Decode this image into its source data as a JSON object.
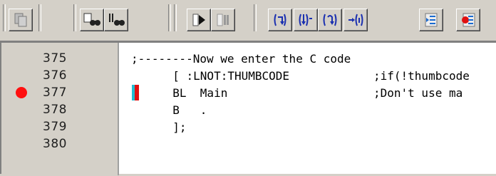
{
  "toolbar": {
    "buttons": [
      {
        "name": "copy-button",
        "icon": "copy-icon"
      },
      {
        "name": "find-button",
        "icon": "find-icon"
      },
      {
        "name": "find-next-button",
        "icon": "find-next-icon"
      },
      {
        "name": "run-button",
        "icon": "run-icon"
      },
      {
        "name": "stop-button",
        "icon": "stop-icon"
      },
      {
        "name": "step-over-button",
        "icon": "step-over-icon"
      },
      {
        "name": "step-into-button",
        "icon": "step-into-icon"
      },
      {
        "name": "step-out-button",
        "icon": "step-out-icon"
      },
      {
        "name": "run-to-cursor-button",
        "icon": "run-to-cursor-icon"
      },
      {
        "name": "indent-button",
        "icon": "indent-icon"
      },
      {
        "name": "breakpoint-button",
        "icon": "breakpoint-icon"
      }
    ]
  },
  "editor": {
    "lines": [
      {
        "number": "375",
        "col1": ";--------Now we enter the C code",
        "col2": "",
        "breakpoint": false,
        "current": false
      },
      {
        "number": "376",
        "col1": "  [ :LNOT:THUMBCODE",
        "col2": ";if(!thumbcode",
        "breakpoint": false,
        "current": false
      },
      {
        "number": "377",
        "col1": "  BL  Main",
        "col2": ";Don't use ma",
        "breakpoint": true,
        "current": true
      },
      {
        "number": "378",
        "col1": "  B   .",
        "col2": "",
        "breakpoint": false,
        "current": false
      },
      {
        "number": "379",
        "col1": "  ];",
        "col2": "",
        "breakpoint": false,
        "current": false
      },
      {
        "number": "380",
        "col1": "",
        "col2": "",
        "breakpoint": false,
        "current": false
      }
    ],
    "colors": {
      "breakpoint": "#ff1010",
      "pc_cyan": "#22bcd0",
      "pc_red": "#e01010"
    }
  }
}
